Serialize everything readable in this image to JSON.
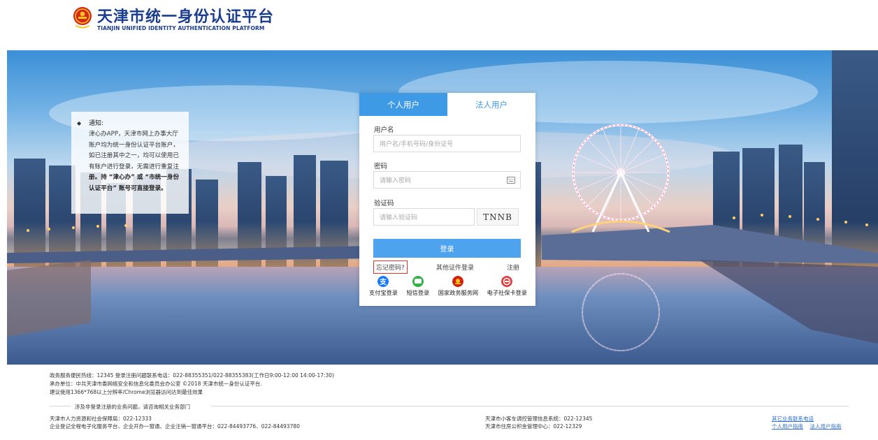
{
  "header": {
    "title": "天津市统一身份认证平台",
    "subtitle": "TIANJIN UNIFIED IDENTITY AUTHENTICATION PLATFORM"
  },
  "notice": {
    "title": "通知:",
    "line1": "津心办APP，天津市网上办事大厅",
    "line2": "账户均为统一身份认证平台账户，",
    "line3": "如已注册其中之一，均可以使用已",
    "line4": "有账户进行登录，无需进行重复注",
    "line5": "册。持 “津心办” 或 “市统一身份",
    "line6": "认证平台” 账号可直接登录。"
  },
  "login": {
    "tabs": [
      {
        "label": "个人用户",
        "active": true
      },
      {
        "label": "法人用户",
        "active": false
      }
    ],
    "username_label": "用户名",
    "username_placeholder": "用户名/手机号码/身份证号",
    "password_label": "密码",
    "password_placeholder": "请输入密码",
    "captcha_label": "验证码",
    "captcha_placeholder": "请输入验证码",
    "captcha_text": "TNNB",
    "login_button": "登录",
    "forgot_password": "忘记密码?",
    "other_cert_login": "其他证件登录",
    "register": "注册",
    "quick_logins": [
      {
        "label": "支付宝登录",
        "icon": "alipay-icon",
        "color": "#1677ff"
      },
      {
        "label": "短信登录",
        "icon": "sms-icon",
        "color": "#2fb344"
      },
      {
        "label": "国家政务服务网",
        "icon": "national-emblem-icon",
        "color": "#d81e06"
      },
      {
        "label": "电子社保卡登录",
        "icon": "social-security-card-icon",
        "color": "#e33b3b"
      }
    ]
  },
  "footer": {
    "line1": "政务服务便民热线：12345 登录注册问题联系电话：022-88355351/022-88355383(工作日9:00-12:00 14:00-17:30)",
    "line2": "承办单位：中共天津市委网络安全和信息化委员会办公室      ©2018 天津市统一身份认证平台.",
    "line3": "建议使用1366*768以上分辨率/Chrome浏览器访问达到最佳效果",
    "separator_text": "涉及非登录注册的业务问题，请咨询相关业务部门",
    "left_col": [
      "天津市人力资源和社会保障局：022-12333",
      "企业登记全程电子化服务平台、企业开办一窗通、企业注销一窗通平台：022-84493776、022-84493780"
    ],
    "mid_col": [
      "天津市小客车调控管理信息系统：022-12345",
      "天津市住房公积金管理中心：022-12329"
    ],
    "right_link1": "其它业务联系电话",
    "right_link2": "个人用户指南",
    "right_link3": "法人用户指南"
  },
  "colors": {
    "brand": "#1a3d8f",
    "accent": "#3f9ae6",
    "highlight_border": "#e0352b"
  }
}
